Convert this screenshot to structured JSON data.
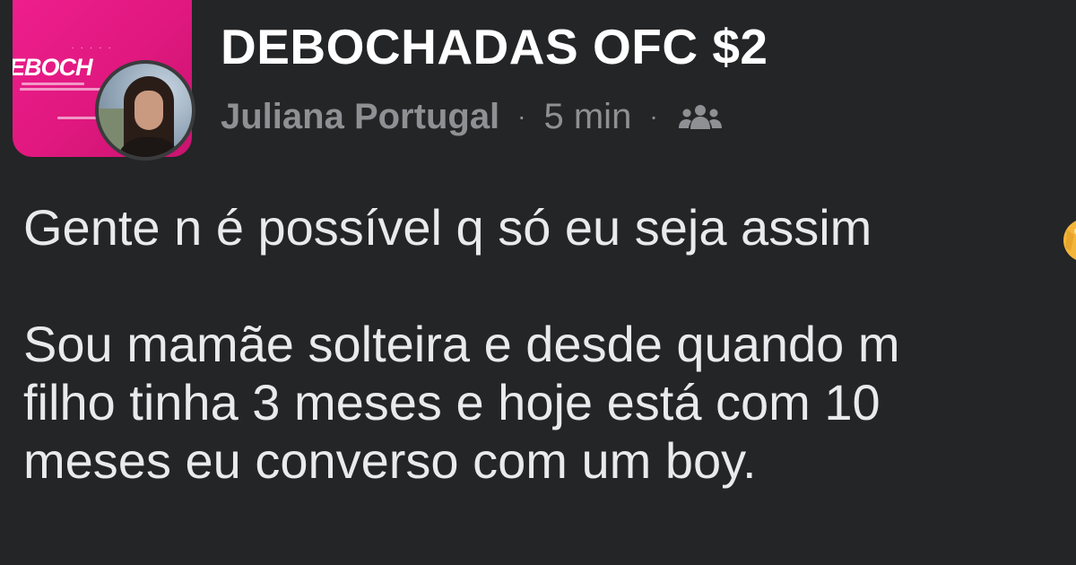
{
  "post": {
    "group_name": "DEBOCHADAS OFC $2",
    "author": "Juliana Portugal",
    "separator": "·",
    "time": "5 min",
    "audience_icon": "group-icon",
    "body_lines": [
      "Gente n é possível q só eu seja assim",
      "",
      "Sou mamãe solteira e desde quando m",
      "filho tinha 3 meses e hoje está com 10",
      "meses eu converso com um boy."
    ],
    "trailing_emoji": "partial-emoji-icon"
  },
  "group_thumbnail": {
    "logo_text": "EBOCH",
    "background_color": "#e81a87"
  },
  "colors": {
    "background": "#242526",
    "title": "#ffffff",
    "meta": "#8e9094",
    "body": "#e9eaed"
  }
}
